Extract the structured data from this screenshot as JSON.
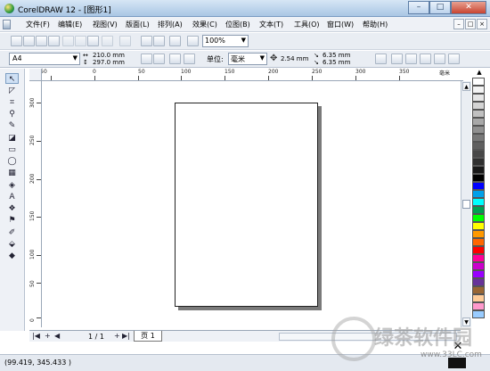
{
  "window": {
    "title": "CorelDRAW 12 - [图形1]",
    "controls": {
      "minimize": "–",
      "maximize": "□",
      "close": "✕"
    }
  },
  "menubar": {
    "items": [
      "文件(F)",
      "编辑(E)",
      "视图(V)",
      "版面(L)",
      "排列(A)",
      "效果(C)",
      "位图(B)",
      "文本(T)",
      "工具(O)",
      "窗口(W)",
      "帮助(H)"
    ],
    "right_controls": [
      "–",
      "□",
      "×"
    ]
  },
  "toolbar": {
    "zoom_value": "100%"
  },
  "property_bar": {
    "page_size": "A4",
    "page_width": "210.0 mm",
    "page_height": "297.0 mm",
    "units_label": "单位:",
    "units_value": "毫米",
    "nudge": "2.54 mm",
    "duplicate_x": "6.35 mm",
    "duplicate_y": "6.35 mm"
  },
  "rulers": {
    "horizontal_labels": [
      "-50",
      "0",
      "50",
      "100",
      "150",
      "200",
      "250",
      "300",
      "350"
    ],
    "horizontal_unit": "毫米",
    "vertical_labels": [
      "300",
      "250",
      "200",
      "150",
      "100",
      "50",
      "0"
    ],
    "vertical_unit": "毫米"
  },
  "pagenav": {
    "page_count": "1 / 1",
    "page_tab": "页 1"
  },
  "status": {
    "coordinates": "(99.419, 345.433 )"
  },
  "watermark": {
    "text": "绿茶软件园",
    "url": "www.33LC.com"
  },
  "palette_colors": [
    "#ffffff",
    "#f4f4f4",
    "#e6e6e6",
    "#d4d4d4",
    "#c0c0c0",
    "#a8a8a8",
    "#909090",
    "#787878",
    "#606060",
    "#484848",
    "#303030",
    "#181818",
    "#000000",
    "#0000ff",
    "#00a0e9",
    "#00ffff",
    "#00a050",
    "#00ff00",
    "#ffff00",
    "#ff9900",
    "#ff6600",
    "#ff0000",
    "#ff0099",
    "#cc00cc",
    "#9900ff",
    "#663399",
    "#996633",
    "#ffcc99",
    "#ff99cc",
    "#99ccff"
  ]
}
